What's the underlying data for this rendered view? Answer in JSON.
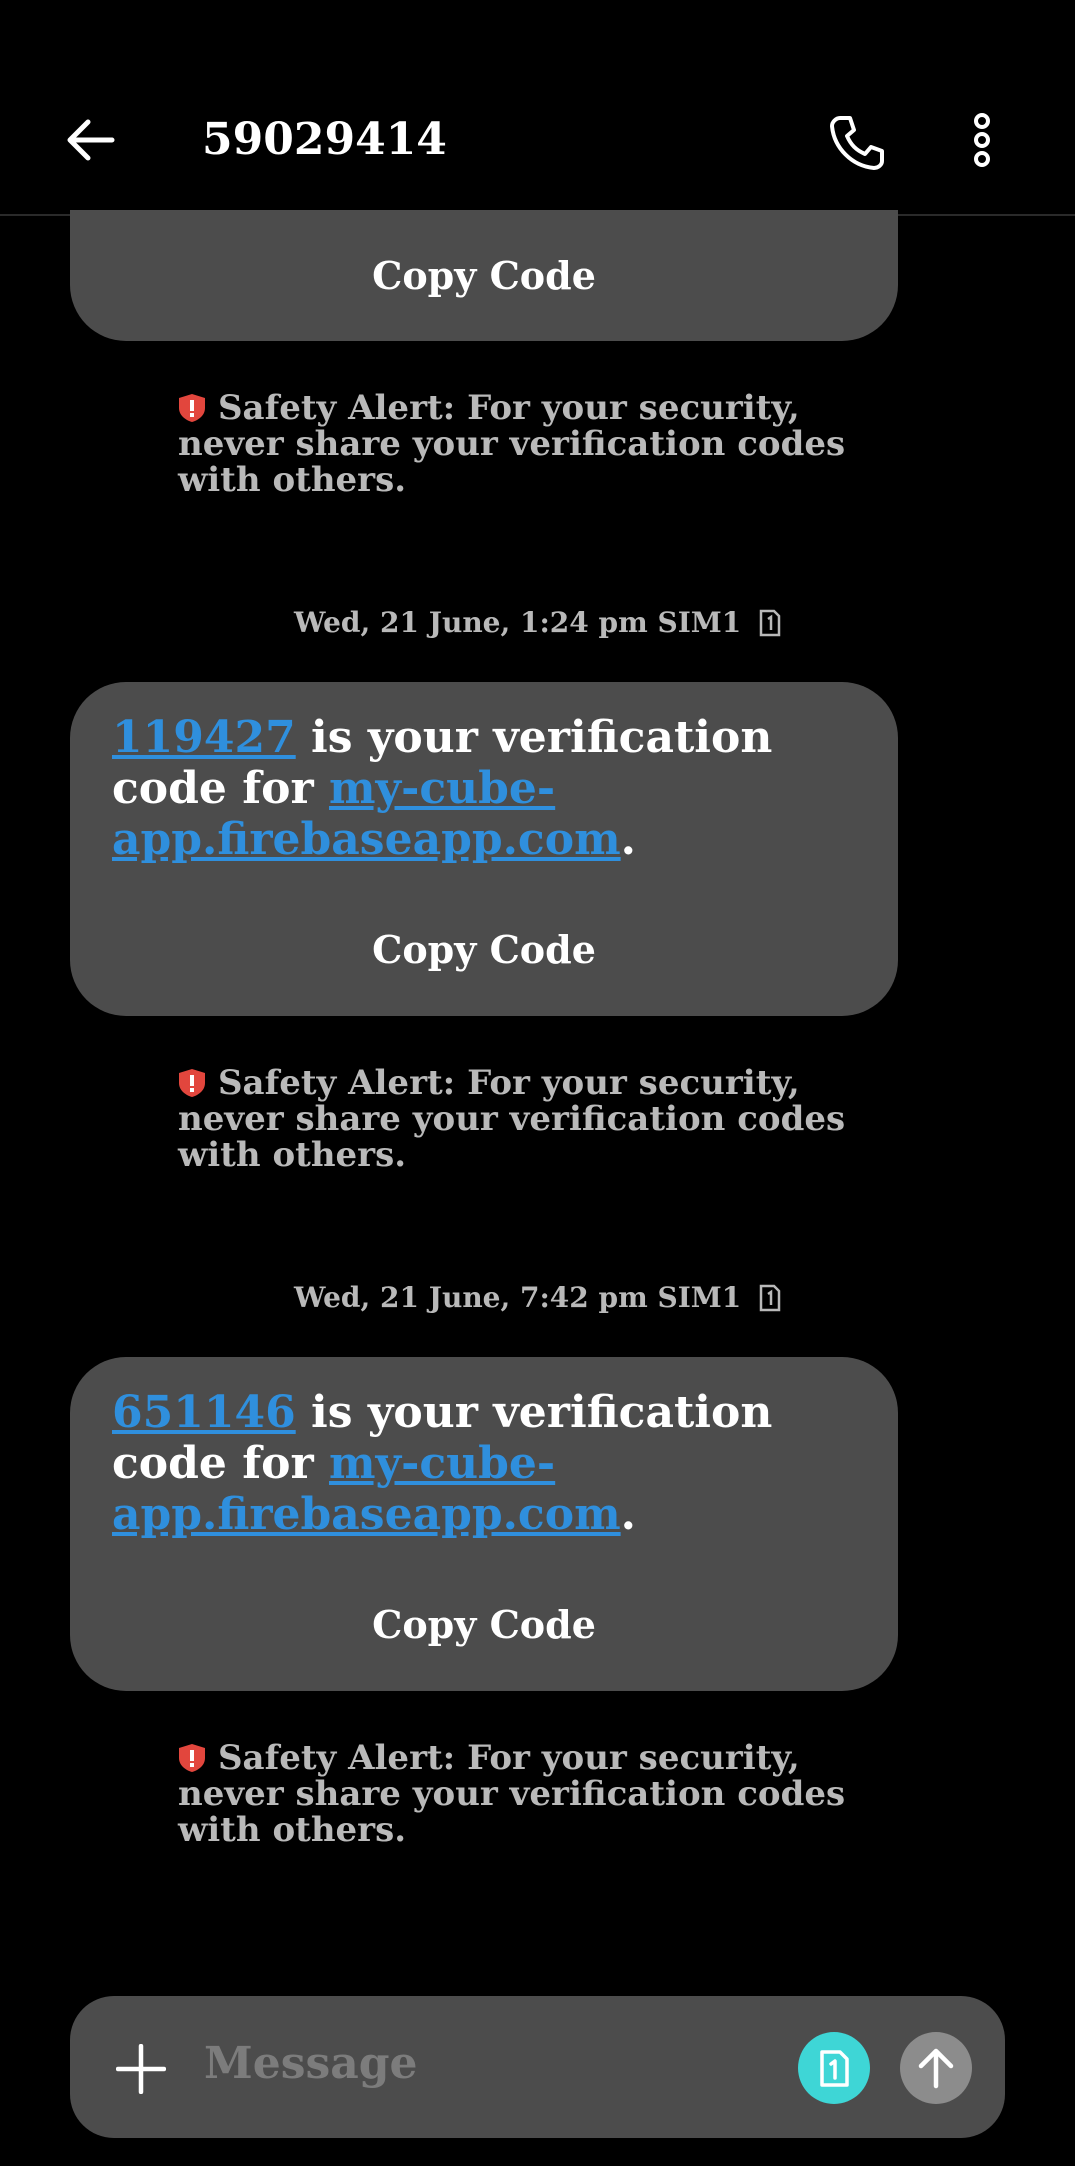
{
  "header": {
    "title": "59029414",
    "back_icon": "arrow-left-icon",
    "call_icon": "phone-icon",
    "more_icon": "more-vertical-icon"
  },
  "messages": [
    {
      "partial": true,
      "copy_label": "Copy Code",
      "alert": "Safety Alert: For your security, never share your verification codes with others."
    },
    {
      "timestamp": "Wed, 21 June, 1:24 pm",
      "sim": "SIM1",
      "code": "119427",
      "text_mid": " is your verification code for ",
      "domain": "my-cube-app.firebaseapp.com",
      "text_end": ".",
      "copy_label": "Copy Code",
      "alert": "Safety Alert: For your security, never share your verification codes with others."
    },
    {
      "timestamp": "Wed, 21 June, 7:42 pm",
      "sim": "SIM1",
      "code": "651146",
      "text_mid": " is your verification code for ",
      "domain": "my-cube-app.firebaseapp.com",
      "text_end": ".",
      "copy_label": "Copy Code",
      "alert": "Safety Alert: For your security, never share your verification codes with others."
    }
  ],
  "composer": {
    "placeholder": "Message",
    "add_icon": "plus-icon",
    "sim_icon": "sim-1-icon",
    "send_icon": "send-arrow-up-icon"
  },
  "colors": {
    "background": "#000000",
    "bubble": "#4c4c4c",
    "link": "#2f8fdd",
    "alert_icon": "#e2463d",
    "sim_button": "#3ed6d6",
    "send_button": "#8c8c8c"
  }
}
